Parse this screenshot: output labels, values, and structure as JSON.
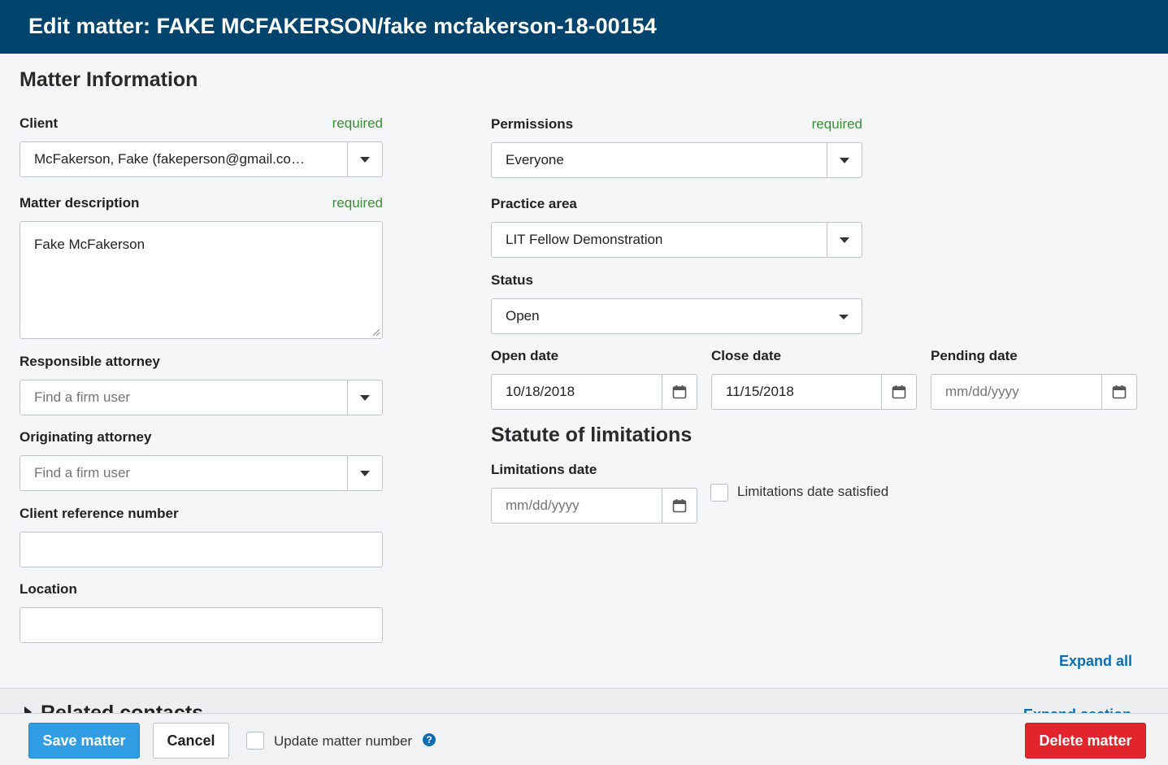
{
  "header": {
    "title": "Edit matter: FAKE MCFAKERSON/fake mcfakerson-18-00154"
  },
  "matter_info": {
    "section_title": "Matter Information"
  },
  "required_label": "required",
  "client": {
    "label": "Client",
    "value": "McFakerson, Fake (fakeperson@gmail.co…"
  },
  "description": {
    "label": "Matter description",
    "value": "Fake McFakerson"
  },
  "responsible_attorney": {
    "label": "Responsible attorney",
    "placeholder": "Find a firm user"
  },
  "originating_attorney": {
    "label": "Originating attorney",
    "placeholder": "Find a firm user"
  },
  "client_reference": {
    "label": "Client reference number",
    "value": ""
  },
  "location": {
    "label": "Location",
    "value": ""
  },
  "permissions": {
    "label": "Permissions",
    "value": "Everyone"
  },
  "practice_area": {
    "label": "Practice area",
    "value": "LIT Fellow Demonstration"
  },
  "status": {
    "label": "Status",
    "value": "Open"
  },
  "open_date": {
    "label": "Open date",
    "value": "10/18/2018"
  },
  "close_date": {
    "label": "Close date",
    "value": "11/15/2018"
  },
  "pending_date": {
    "label": "Pending date",
    "placeholder": "mm/dd/yyyy"
  },
  "statute": {
    "section_title": "Statute of limitations",
    "limitations_label": "Limitations date",
    "limitations_placeholder": "mm/dd/yyyy",
    "satisfied_label": "Limitations date satisfied"
  },
  "expand_all": "Expand all",
  "related_contacts": {
    "title": "Related contacts",
    "expand_section": "Expand section"
  },
  "footer": {
    "save": "Save matter",
    "cancel": "Cancel",
    "update_number": "Update matter number",
    "delete": "Delete matter"
  },
  "colors": {
    "header_bg": "#00436d",
    "primary": "#2f9ce4",
    "danger": "#e2242c",
    "required": "#3a8f34",
    "link": "#0b6eb4"
  },
  "icons": {
    "dropdown": "caret-down-icon",
    "calendar": "calendar-icon",
    "help": "question-circle-icon",
    "collapse": "caret-right-icon"
  }
}
